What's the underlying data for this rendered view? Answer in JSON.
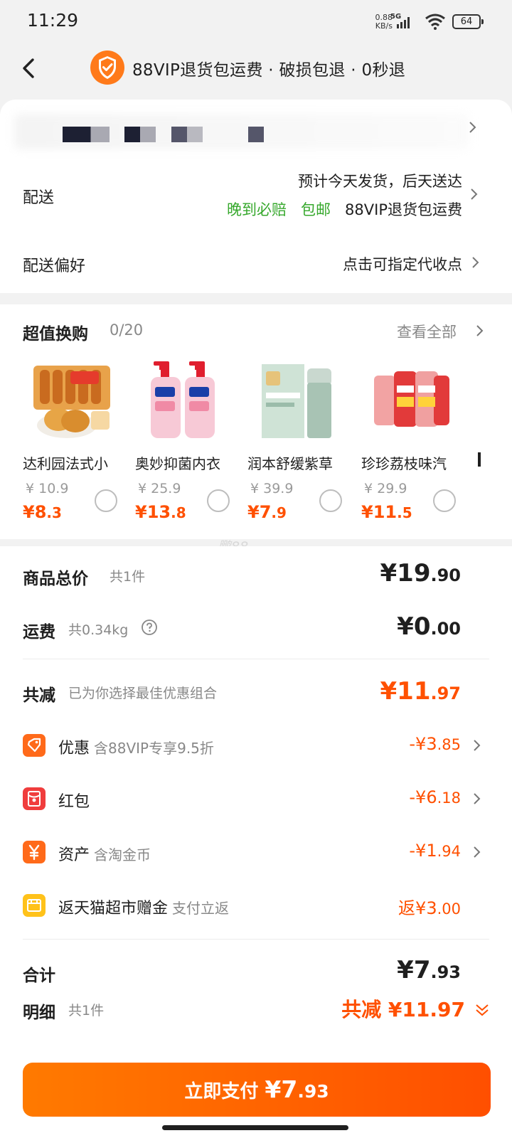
{
  "status_bar": {
    "time": "11:29",
    "net_speed": "0.88",
    "net_speed_unit": "KB/s",
    "network": "5G",
    "battery": "64"
  },
  "header": {
    "title": "88VIP退货包运费 · 破损包退 · 0秒退",
    "icon": "shield-check-icon"
  },
  "delivery": {
    "label": "配送",
    "estimate": "预计今天发货，后天送达",
    "tags": [
      "晚到必赔",
      "包邮"
    ],
    "service": "88VIP退货包运费"
  },
  "delivery_pref": {
    "label": "配送偏好",
    "value": "点击可指定代收点"
  },
  "deals": {
    "title": "超值换购",
    "count": "0/20",
    "view_all": "查看全部",
    "items": [
      {
        "name": "达利园法式小",
        "old_price": "¥ 10.9",
        "price_int": "¥8",
        "price_dec": ".3"
      },
      {
        "name": "奥妙抑菌内衣",
        "old_price": "¥ 25.9",
        "price_int": "¥13",
        "price_dec": ".8"
      },
      {
        "name": "润本舒缓紫草",
        "old_price": "¥ 39.9",
        "price_int": "¥7",
        "price_dec": ".9"
      },
      {
        "name": "珍珍荔枝味汽",
        "old_price": "¥ 29.9",
        "price_int": "¥11",
        "price_dec": ".5"
      }
    ]
  },
  "watermark": "鹏88",
  "summary": {
    "goods_label": "商品总价",
    "goods_sub": "共1件",
    "goods_int": "¥19",
    "goods_dec": ".90",
    "ship_label": "运费",
    "ship_sub": "共0.34kg",
    "ship_int": "¥0",
    "ship_dec": ".00",
    "reduce_label": "共减",
    "reduce_sub": "已为你选择最佳优惠组合",
    "reduce_int": "¥11",
    "reduce_dec": ".97"
  },
  "discounts": [
    {
      "label": "优惠",
      "sub": "含88VIP专享9.5折",
      "val_int": "-¥3",
      "val_dec": ".85",
      "icon": "tag-icon"
    },
    {
      "label": "红包",
      "sub": "",
      "val_int": "-¥6",
      "val_dec": ".18",
      "icon": "red-envelope-icon"
    },
    {
      "label": "资产",
      "sub": "含淘金币",
      "val_int": "-¥1",
      "val_dec": ".94",
      "icon": "yuan-icon"
    },
    {
      "label": "返天猫超市赠金",
      "sub": "支付立返",
      "val_int": "返¥3",
      "val_dec": ".00",
      "icon": "gift-card-icon"
    }
  ],
  "total": {
    "label": "合计",
    "int": "¥7",
    "dec": ".93",
    "detail_label": "明细",
    "detail_sub": "共1件",
    "reduce_text": "共减 ¥11.97"
  },
  "pay_button": {
    "label": "立即支付",
    "int": "¥7",
    "dec": ".93"
  },
  "colors": {
    "accent": "#ff5000",
    "green": "#36a82c"
  }
}
